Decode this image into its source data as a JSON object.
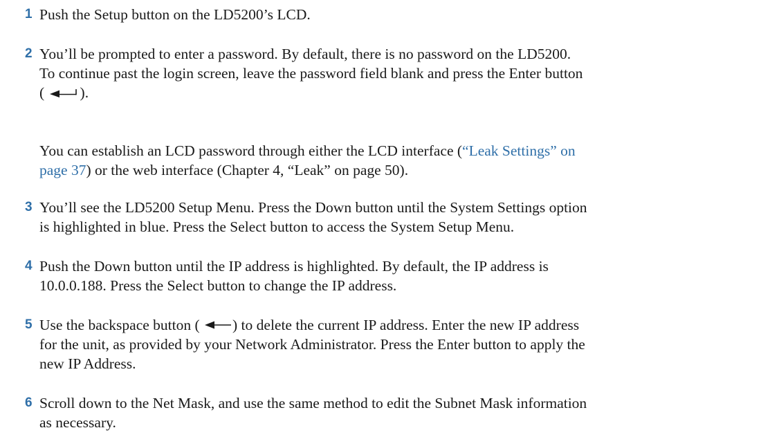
{
  "steps": [
    {
      "number": "1",
      "lines": [
        "Push the Setup button on the LD5200’s LCD."
      ]
    },
    {
      "number": "2",
      "lines": [
        "You’ll be prompted to enter a password. By default, there is no password on the LD5200.",
        "To continue past the login screen, leave the password field blank and press the Enter button"
      ],
      "enter_open": "(",
      "enter_close": ").",
      "enter_icon": "enter-arrow-icon"
    },
    {
      "number": "3",
      "lines": [
        "You’ll see the LD5200 Setup Menu. Press the Down button until the System Settings option",
        "is highlighted in blue. Press the Select button to access the System Setup Menu."
      ]
    },
    {
      "number": "4",
      "lines": [
        "Push the Down button until the IP address is highlighted. By default, the IP address is",
        "10.0.0.188. Press the Select button to change the IP address."
      ]
    },
    {
      "number": "5",
      "line1_before": "Use the backspace button (",
      "line1_after": ") to delete the current IP address. Enter the new IP address",
      "backspace_icon": "backspace-arrow-icon",
      "lines": [
        "for the unit, as provided by your Network Administrator. Press the Enter button to apply the",
        "new IP Address."
      ]
    },
    {
      "number": "6",
      "lines": [
        "Scroll down to the Net Mask, and use the same method to edit the Subnet Mask information",
        "as necessary."
      ]
    }
  ],
  "password_note": {
    "line1_before": "You can establish an LCD password through either the LCD interface (",
    "line1_link": "“Leak Settings” on",
    "line2_link": "page 37",
    "line2_after": ") or the web interface (Chapter 4, “Leak” on page 50).",
    "link_color": "#2f6fa8"
  },
  "colors": {
    "step_number": "#2f6fa8",
    "body_text": "#1a1a1a"
  }
}
